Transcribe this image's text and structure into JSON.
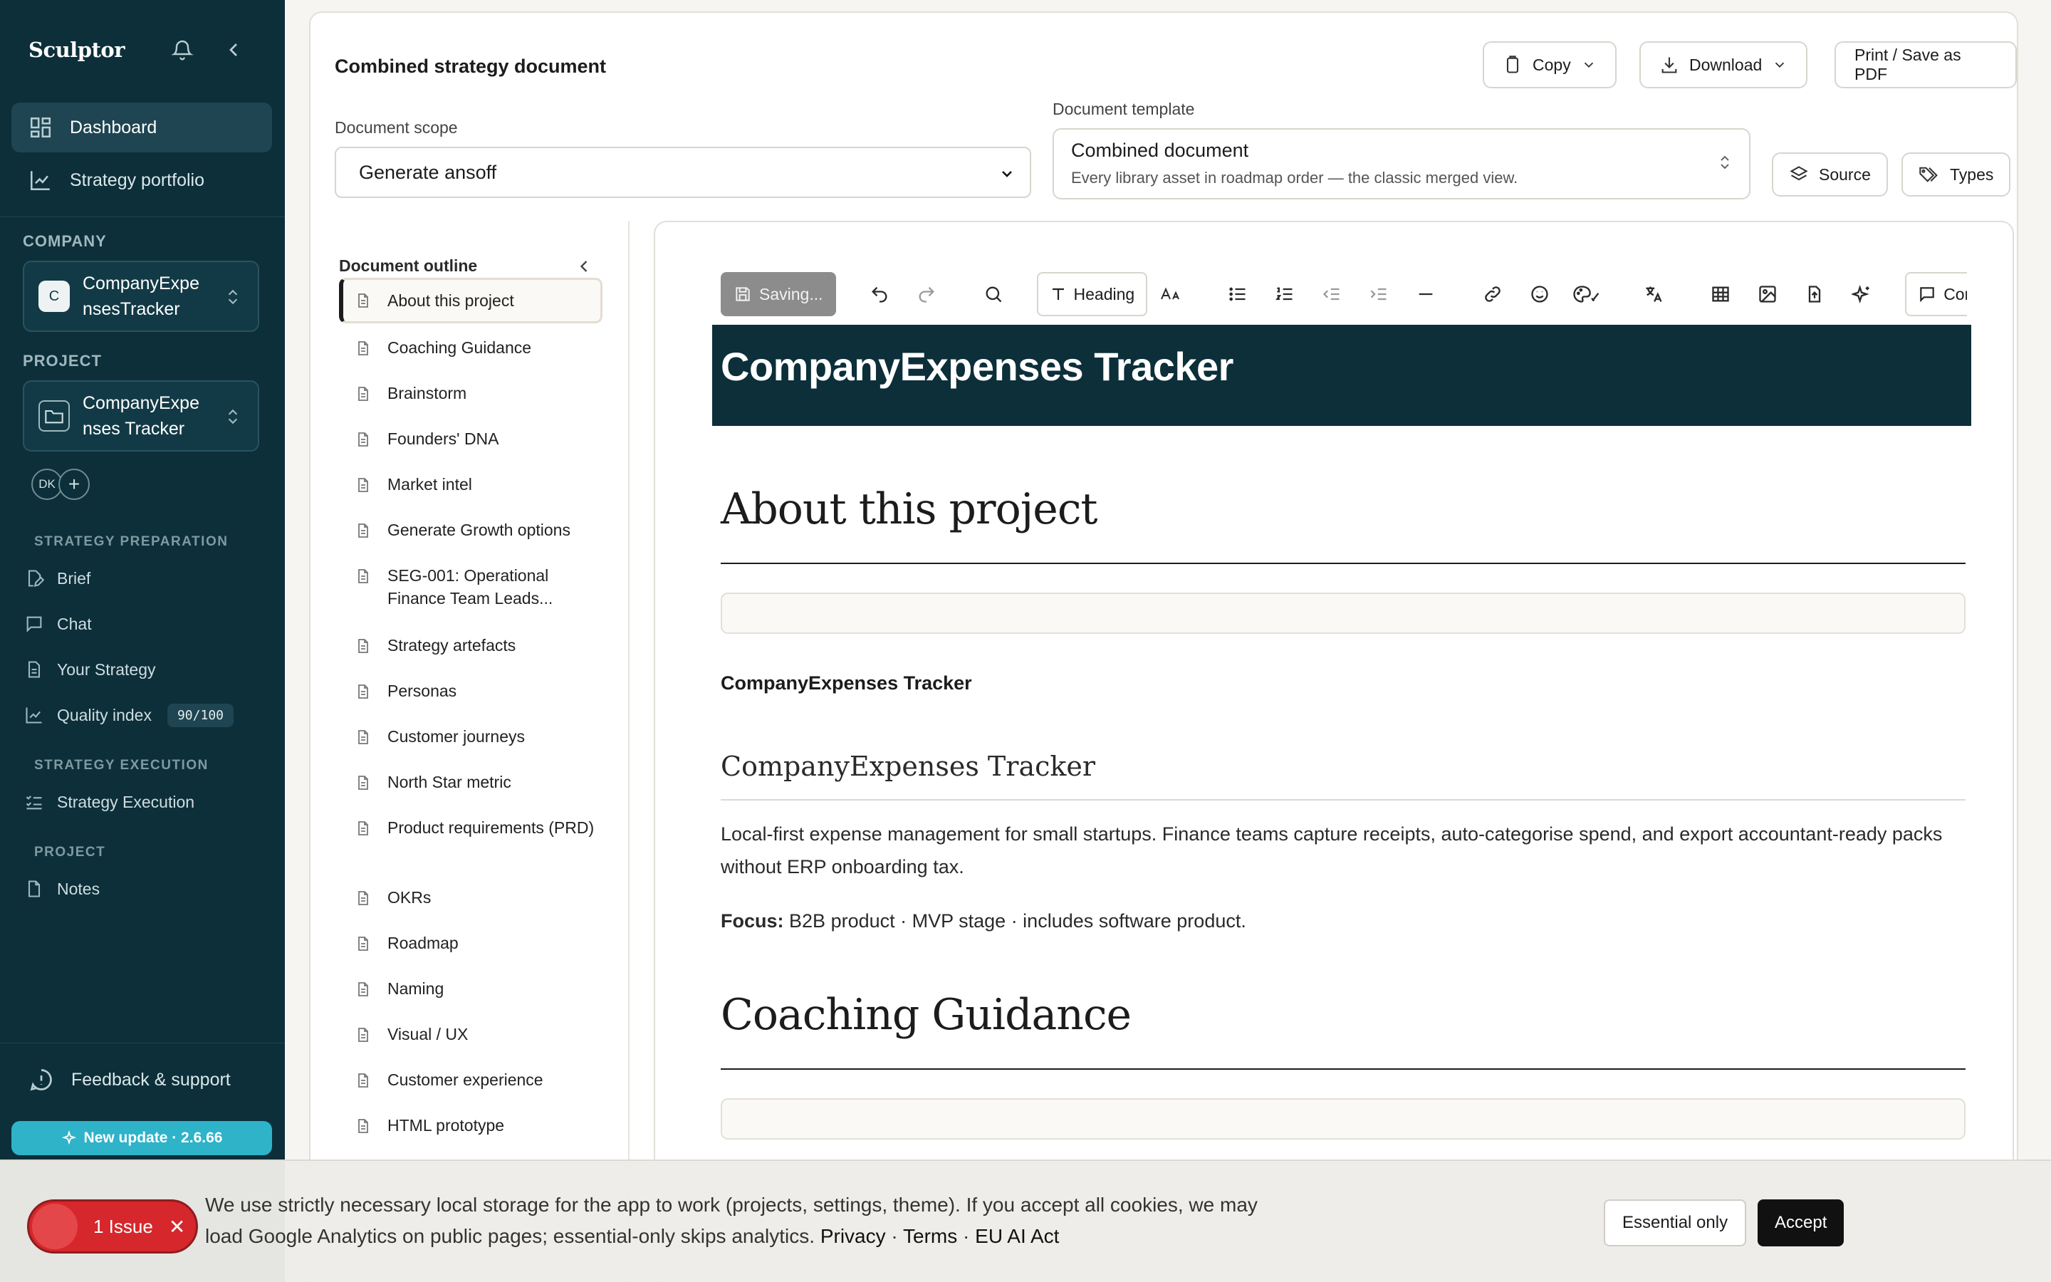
{
  "sidebar": {
    "brand": "Sculptor",
    "nav": [
      {
        "label": "Dashboard",
        "icon": "grid-icon",
        "active": true
      },
      {
        "label": "Strategy portfolio",
        "icon": "chart-line-icon",
        "active": false
      }
    ],
    "company_label": "COMPANY",
    "company": {
      "avatar": "C",
      "line1": "CompanyExpe",
      "line2": "nsesTracker"
    },
    "project_label": "PROJECT",
    "project": {
      "line1": "CompanyExpe",
      "line2": "nses Tracker"
    },
    "member_initials": "DK",
    "add_member": "+",
    "sections": [
      {
        "label": "STRATEGY PREPARATION",
        "items": [
          "Brief",
          "Chat",
          "Your Strategy",
          "Quality index"
        ]
      },
      {
        "label": "STRATEGY EXECUTION",
        "items": [
          "Strategy Execution"
        ]
      },
      {
        "label": "PROJECT",
        "items": [
          "Notes"
        ]
      }
    ],
    "quality_score": "90/100",
    "feedback": "Feedback & support",
    "update": "New update · 2.6.66",
    "accent": "#2eb3c9",
    "background": "#0c2f3a"
  },
  "header": {
    "title": "Combined strategy document",
    "copy": "Copy",
    "download": "Download",
    "print": "Print / Save as PDF",
    "scope_label": "Document scope",
    "scope_value": "Generate ansoff",
    "template_label": "Document template",
    "template_value": "Combined document",
    "template_desc": "Every library asset in roadmap order — the classic merged view.",
    "source": "Source",
    "types": "Types"
  },
  "outline": {
    "title": "Document outline",
    "items": [
      "About this project",
      "Coaching Guidance",
      "Brainstorm",
      "Founders' DNA",
      "Market intel",
      "Generate Growth options",
      "SEG-001: Operational Finance Team Leads...",
      "Strategy artefacts",
      "Personas",
      "Customer journeys",
      "North Star metric",
      "Product requirements (PRD)",
      "OKRs",
      "Roadmap",
      "Naming",
      "Visual / UX",
      "Customer experience",
      "HTML prototype"
    ]
  },
  "editor": {
    "saving": "Saving...",
    "heading_btn": "Heading",
    "comment_btn": "Comm",
    "banner_title": "CompanyExpenses Tracker",
    "section1_title": "About this project",
    "project_bold": "CompanyExpenses Tracker",
    "subheading": "CompanyExpenses Tracker",
    "description": "Local-first expense management for small startups. Finance teams capture receipts, auto-categorise spend, and export accountant-ready packs without ERP onboarding tax.",
    "focus_label": "Focus:",
    "focus_value": "B2B product · MVP stage · includes software product.",
    "section2_title": "Coaching Guidance"
  },
  "cookie": {
    "issue": "1 Issue",
    "text": "We use strictly necessary local storage for the app to work (projects, settings, theme). If you accept all cookies, we may load Google Analytics on public pages; essential-only skips analytics.",
    "privacy": "Privacy",
    "terms": "Terms",
    "eu_act": "EU AI Act",
    "sep": "·",
    "essential": "Essential only",
    "accept": "Accept"
  }
}
